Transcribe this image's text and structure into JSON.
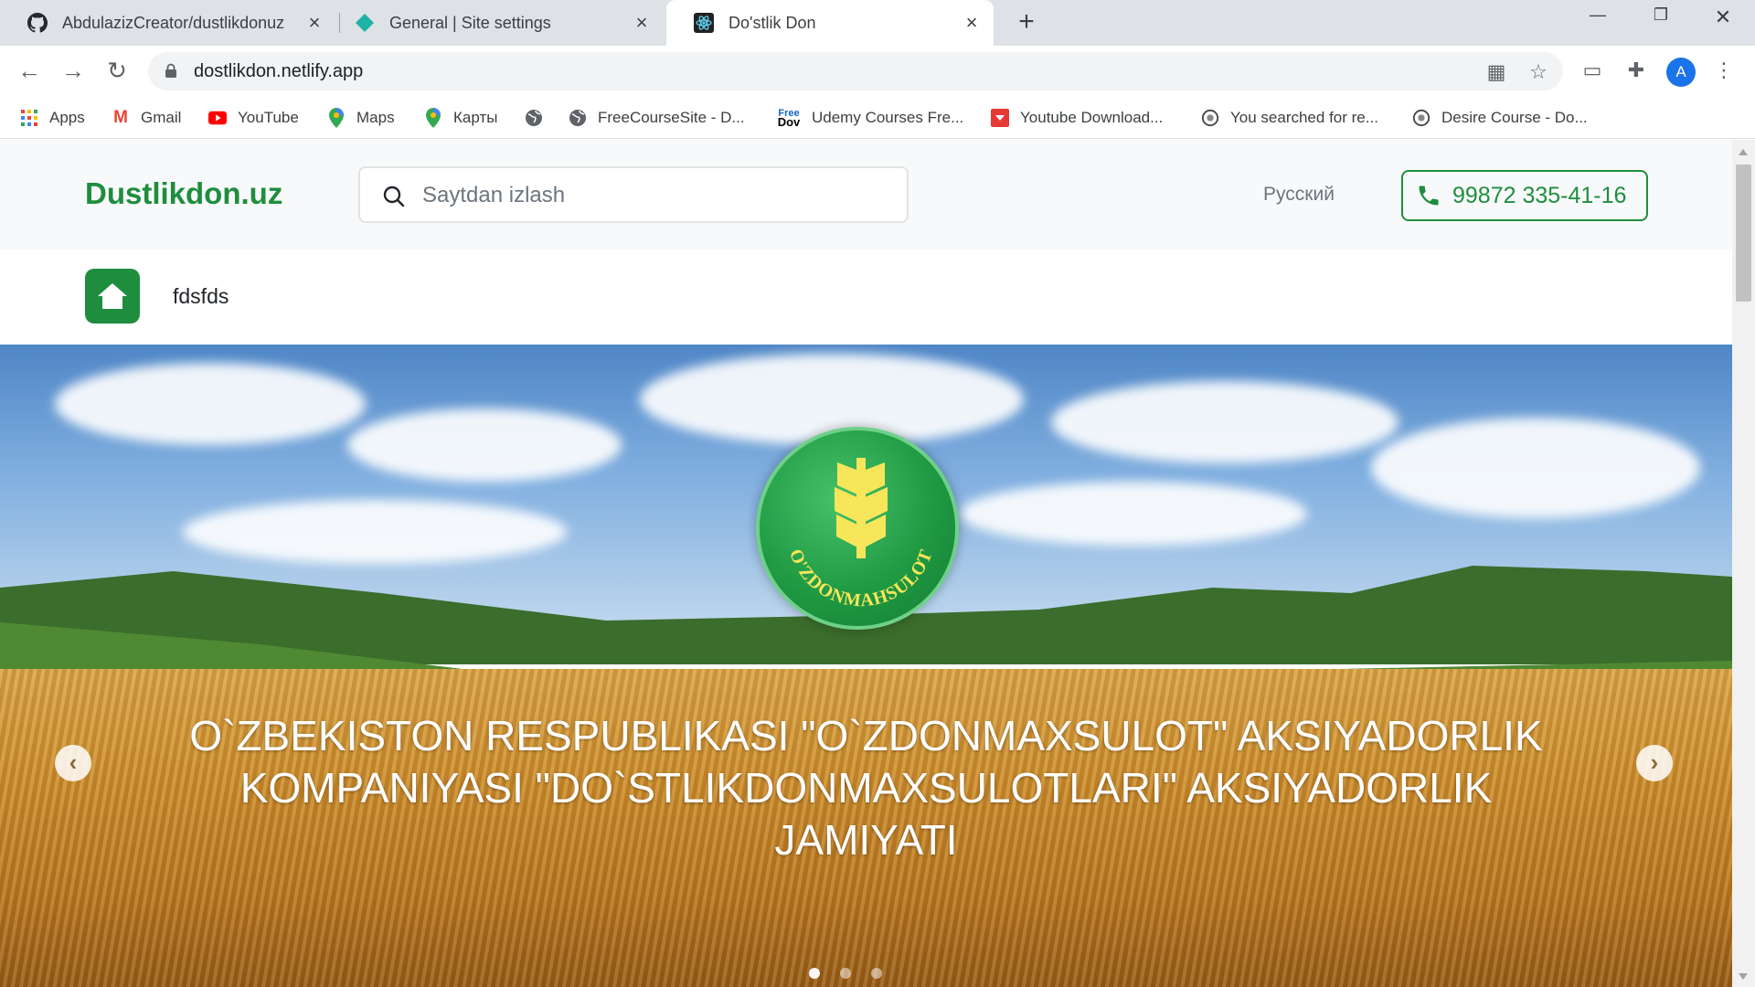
{
  "browser": {
    "tabs": [
      {
        "label": "AbdulazizCreator/dustlikdonuz",
        "icon": "github-icon"
      },
      {
        "label": "General | Site settings",
        "icon": "netlify-icon"
      },
      {
        "label": "Do'stlik Don",
        "icon": "react-icon",
        "active": true
      }
    ],
    "new_tab": "+",
    "url": "dostlikdon.netlify.app",
    "profile_initial": "A",
    "bookmarks": [
      {
        "label": "Apps",
        "icon": "apps-grid-icon"
      },
      {
        "label": "Gmail",
        "icon": "gmail-icon"
      },
      {
        "label": "YouTube",
        "icon": "youtube-icon"
      },
      {
        "label": "Maps",
        "icon": "maps-pin-icon"
      },
      {
        "label": "Карты",
        "icon": "maps-pin-icon"
      },
      {
        "label": "",
        "icon": "globe-icon"
      },
      {
        "label": "FreeCourseSite - D...",
        "icon": "globe-icon"
      },
      {
        "label": "Udemy Courses Fre...",
        "icon": "freedownload-icon"
      },
      {
        "label": "Youtube Download...",
        "icon": "download-icon"
      },
      {
        "label": "You searched for re...",
        "icon": "site-logo-icon"
      },
      {
        "label": "Desire Course - Do...",
        "icon": "site-logo-icon"
      }
    ]
  },
  "site": {
    "logo": "Dustlikdon.uz",
    "search_placeholder": "Saytdan izlash",
    "language": "Русский",
    "phone": "99872 335-41-16",
    "subnav_label": "fdsfds",
    "hero": {
      "caption": "O`ZBEKISTON RESPUBLIKASI \"O`ZDONMAXSULOT\" AKSIYADORLIK KOMPANIYASI \"DO`STLIKDONMAXSULOTLARI\" AKSIYADORLIK JAMIYATI",
      "emblem_text": "O'ZDONMAHSULOT",
      "slides": 3,
      "active_slide": 1
    }
  },
  "colors": {
    "brand_green": "#1e8e3e",
    "tab_strip": "#dee1e6"
  }
}
